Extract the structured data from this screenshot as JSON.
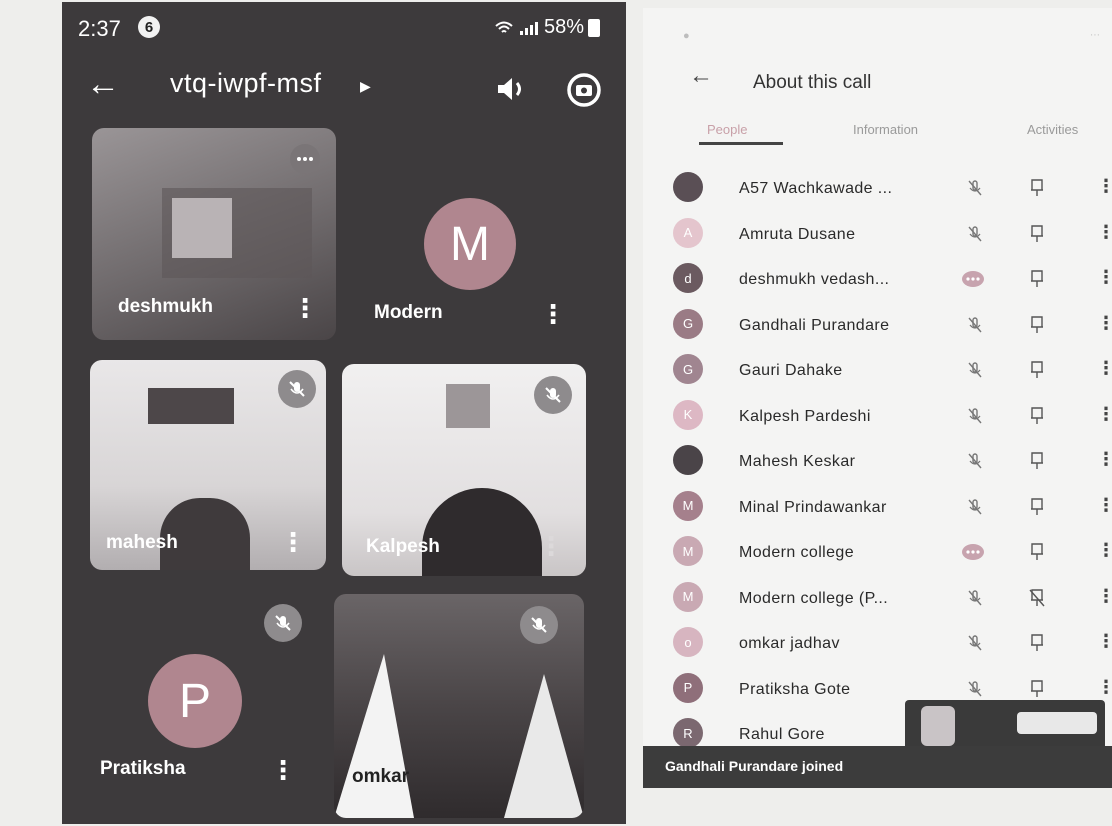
{
  "left_screen": {
    "status": {
      "time": "2:37",
      "notif_count": "6",
      "battery": "58%"
    },
    "header": {
      "meeting_code": "vtq-iwpf-msf"
    },
    "tiles": [
      {
        "name": "deshmukh"
      },
      {
        "name": "Modern",
        "avatar_letter": "M"
      },
      {
        "name": "mahesh"
      },
      {
        "name": "Kalpesh"
      },
      {
        "name": "Pratiksha",
        "avatar_letter": "P"
      },
      {
        "name": "omkar"
      }
    ]
  },
  "right_screen": {
    "header": {
      "title": "About this call"
    },
    "tabs": [
      "People",
      "Information",
      "Activities"
    ],
    "people": [
      {
        "name": "A57 Wachkawade ...",
        "initial": "",
        "color": "#5a4f55",
        "mic": "muted",
        "pin": "pin"
      },
      {
        "name": "Amruta Dusane",
        "initial": "A",
        "color": "#e4c5cd",
        "mic": "muted",
        "pin": "pin"
      },
      {
        "name": "deshmukh vedash...",
        "initial": "d",
        "color": "#6b5a60",
        "mic": "active",
        "pin": "pin"
      },
      {
        "name": "Gandhali Purandare",
        "initial": "G",
        "color": "#9a7b85",
        "mic": "muted",
        "pin": "pin"
      },
      {
        "name": "Gauri Dahake",
        "initial": "G",
        "color": "#a08590",
        "mic": "muted",
        "pin": "pin"
      },
      {
        "name": "Kalpesh Pardeshi",
        "initial": "K",
        "color": "#ddb8c4",
        "mic": "muted",
        "pin": "pin"
      },
      {
        "name": "Mahesh Keskar",
        "initial": "",
        "color": "#4a4448",
        "mic": "muted",
        "pin": "pin"
      },
      {
        "name": "Minal Prindawankar",
        "initial": "M",
        "color": "#a5808c",
        "mic": "muted",
        "pin": "pin"
      },
      {
        "name": "Modern college",
        "initial": "M",
        "color": "#c9a9b3",
        "mic": "active",
        "pin": "pin"
      },
      {
        "name": "Modern college (P...",
        "initial": "M",
        "color": "#c9a9b3",
        "mic": "muted",
        "pin": "pinned"
      },
      {
        "name": "omkar jadhav",
        "initial": "o",
        "color": "#d7b5c0",
        "mic": "muted",
        "pin": "pin"
      },
      {
        "name": "Pratiksha Gote",
        "initial": "P",
        "color": "#8f6f7a",
        "mic": "muted",
        "pin": "pin"
      },
      {
        "name": "Rahul Gore",
        "initial": "R",
        "color": "#7b6870",
        "mic": "",
        "pin": ""
      }
    ],
    "toast": "Gandhali Purandare joined"
  }
}
